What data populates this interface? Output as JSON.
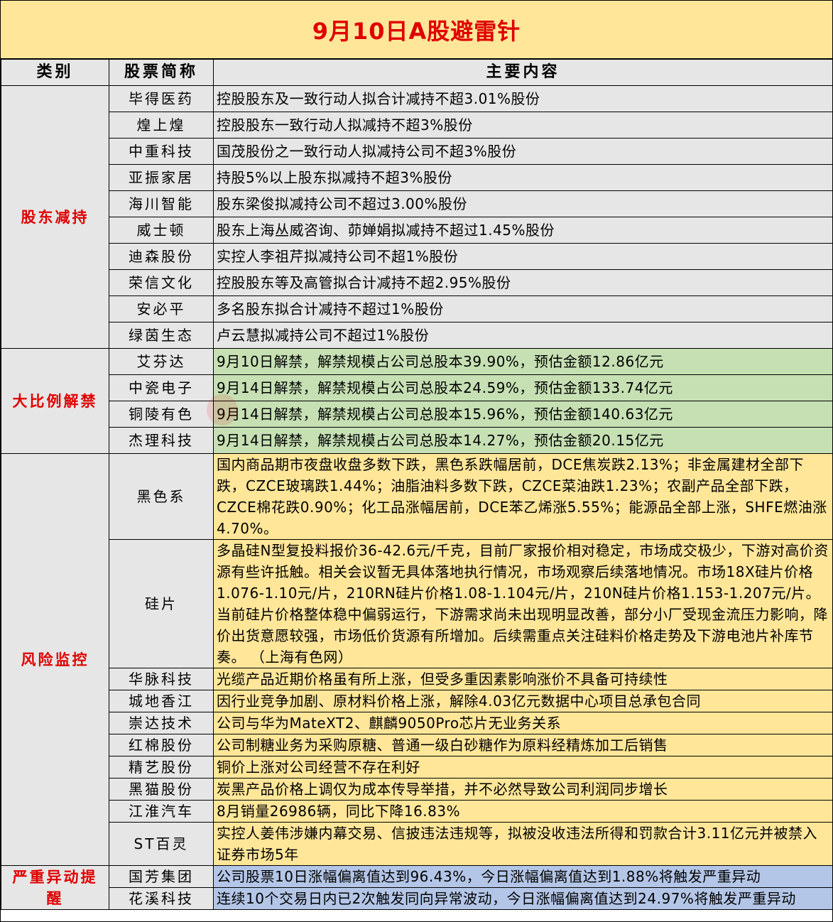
{
  "title": "9月10日A股避雷针",
  "headers": {
    "category": "类别",
    "stock": "股票简称",
    "content": "主要内容"
  },
  "colors": {
    "title_bg": "#FFE699",
    "header_bg": "#E7E6E6",
    "category_text": "#E00000",
    "green": "#C6E0B4",
    "yellow": "#FFE699",
    "blue": "#B4C6E7"
  },
  "sections": [
    {
      "category": "股东减持",
      "rows": [
        {
          "stock": "毕得医药",
          "content": "控股股东及一致行动人拟合计减持不超3.01%股份"
        },
        {
          "stock": "煌上煌",
          "content": "控股股东一致行动人拟减持不超3%股份"
        },
        {
          "stock": "中重科技",
          "content": "国茂股份之一致行动人拟减持公司不超3%股份"
        },
        {
          "stock": "亚振家居",
          "content": "持股5%以上股东拟减持不超3%股份"
        },
        {
          "stock": "海川智能",
          "content": "股东梁俊拟减持公司不超过3.00%股份"
        },
        {
          "stock": "威士顿",
          "content": "股东上海丛威咨询、茆婵娟拟减持不超过1.45%股份"
        },
        {
          "stock": "迪森股份",
          "content": "实控人李祖芹拟减持公司不超1%股份"
        },
        {
          "stock": "荣信文化",
          "content": "控股股东等及高管拟合计减持不超2.95%股份"
        },
        {
          "stock": "安必平",
          "content": "多名股东拟合计减持不超过1%股份"
        },
        {
          "stock": "绿茵生态",
          "content": "卢云慧拟减持公司不超过1%股份"
        }
      ]
    },
    {
      "category": "大比例解禁",
      "rows": [
        {
          "stock": "艾芬达",
          "content": "9月10日解禁，解禁规模占公司总股本39.90%，预估金额12.86亿元"
        },
        {
          "stock": "中瓷电子",
          "content": "9月14日解禁，解禁规模占公司总股本24.59%，预估金额133.74亿元"
        },
        {
          "stock": "铜陵有色",
          "content": "9月14日解禁，解禁规模占公司总股本15.96%，预估金额140.63亿元"
        },
        {
          "stock": "杰理科技",
          "content": "9月14日解禁，解禁规模占公司总股本14.27%，预估金额20.15亿元"
        }
      ]
    },
    {
      "category": "风险监控",
      "rows": [
        {
          "stock": "黑色系",
          "content": "国内商品期市夜盘收盘多数下跌，黑色系跌幅居前，DCE焦炭跌2.13%；非金属建材全部下跌，CZCE玻璃跌1.44%；油脂油料多数下跌，CZCE菜油跌1.23%；农副产品全部下跌，CZCE棉花跌0.90%；化工品涨幅居前，DCE苯乙烯涨5.55%；能源品全部上涨，SHFE燃油涨4.70%。"
        },
        {
          "stock": "硅片",
          "content": "多晶硅N型复投料报价36-42.6元/千克，目前厂家报价相对稳定，市场成交极少，下游对高价资源有些许抵触。相关会议暂无具体落地执行情况，市场观察后续落地情况。市场18X硅片价格1.076-1.10元/片，210RN硅片价格1.08-1.104元/片，210N硅片价格1.153-1.207元/片。当前硅片价格整体稳中偏弱运行，下游需求尚未出现明显改善，部分小厂受现金流压力影响，降价出货意愿较强，市场低价货源有所增加。后续需重点关注硅料价格走势及下游电池片补库节奏。 （上海有色网）"
        },
        {
          "stock": "华脉科技",
          "content": "光缆产品近期价格虽有所上涨，但受多重因素影响涨价不具备可持续性"
        },
        {
          "stock": "城地香江",
          "content": "因行业竞争加剧、原材料价格上涨，解除4.03亿元数据中心项目总承包合同"
        },
        {
          "stock": "崇达技术",
          "content": "公司与华为MateXT2、麒麟9050Pro芯片无业务关系"
        },
        {
          "stock": "红棉股份",
          "content": "公司制糖业务为采购原糖、普通一级白砂糖作为原料经精炼加工后销售"
        },
        {
          "stock": "精艺股份",
          "content": "铜价上涨对公司经营不存在利好"
        },
        {
          "stock": "黑猫股份",
          "content": "炭黑产品价格上调仅为成本传导举措，并不必然导致公司利润同步增长"
        },
        {
          "stock": "江淮汽车",
          "content": "8月销量26986辆，同比下降16.83%"
        },
        {
          "stock": "ST百灵",
          "content": "实控人姜伟涉嫌内幕交易、信披违法违规等，拟被没收违法所得和罚款合计3.11亿元并被禁入证券市场5年"
        }
      ]
    },
    {
      "category": "严重异动提醒",
      "rows": [
        {
          "stock": "国芳集团",
          "content": "公司股票10日涨幅偏离值达到96.43%，今日涨幅偏离值达到1.88%将触发严重异动"
        },
        {
          "stock": "花溪科技",
          "content": "连续10个交易日内已2次触发同向异常波动，今日涨幅偏离值达到24.97%将触发严重异动"
        }
      ]
    }
  ]
}
